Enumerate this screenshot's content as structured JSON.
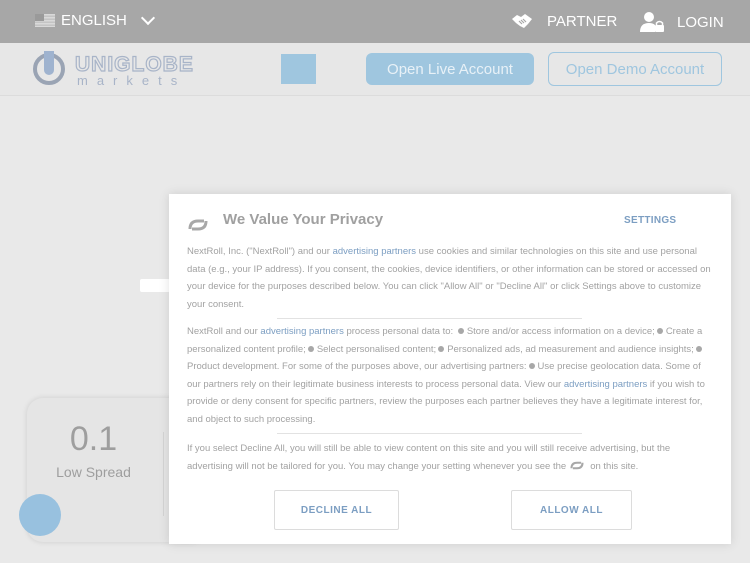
{
  "topbar": {
    "language": "ENGLISH",
    "partner": "PARTNER",
    "login": "LOGIN"
  },
  "header": {
    "logo_top": "UNIGLOBE",
    "logo_bottom": "markets",
    "open_live": "Open Live Account",
    "open_demo": "Open Demo Account"
  },
  "stat_card": {
    "value": "0.1",
    "label": "Low Spread"
  },
  "privacy": {
    "title": "We Value Your Privacy",
    "settings": "SETTINGS",
    "p1_a": "NextRoll, Inc. (\"NextRoll\") and our ",
    "p1_link": "advertising partners",
    "p1_b": " use cookies and similar technologies on this site and use personal data (e.g., your IP address). If you consent, the cookies, device identifiers, or other information can be stored or accessed on your device for the purposes described below. You can click \"Allow All\" or \"Decline All\" or click Settings above to customize your consent.",
    "p2_a": "NextRoll and our ",
    "p2_link": "advertising partners",
    "p2_b": " process personal data to: ",
    "purposes": [
      "Store and/or access information on a device;",
      "Create a personalized content profile;",
      "Select personalised content;",
      "Personalized ads, ad measurement and audience insights;",
      "Product development. For some of the purposes above, our advertising partners:",
      "Use precise geolocation data. Some of our partners rely on their legitimate business interests to process personal data. View our"
    ],
    "p2_link2": "advertising partners",
    "p2_c": " if you wish to provide or deny consent for specific partners, review the purposes each partner believes they have a legitimate interest for, and object to such processing.",
    "p3_a": "If you select Decline All, you will still be able to view content on this site and you will still receive advertising, but the advertising will not be tailored for you. You may change your setting whenever you see the",
    "p3_b": "on this site.",
    "decline": "DECLINE ALL",
    "allow": "ALLOW ALL"
  },
  "colors": {
    "accent_blue": "#9fc6df",
    "link_blue": "#7c9ec2",
    "topbar_gray": "#a7a7a7"
  },
  "icons": {
    "flag": "us-flag-icon",
    "chevron": "chevron-down-icon",
    "partner": "handshake-icon",
    "login": "user-lock-icon",
    "nextroll": "nextroll-logo-icon",
    "chat": "chat-bubble-icon"
  }
}
